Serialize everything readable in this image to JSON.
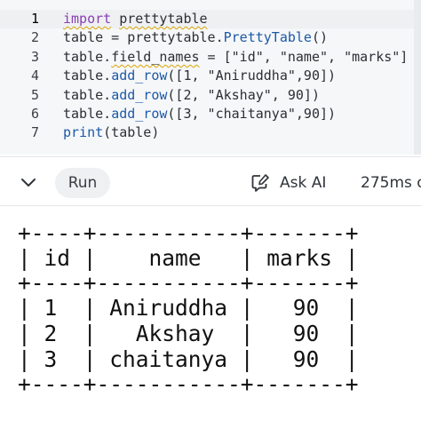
{
  "editor": {
    "lines": [
      {
        "n": "1",
        "parts": [
          {
            "t": "import",
            "c": "kw squiggle"
          },
          {
            "t": " ",
            "c": ""
          },
          {
            "t": "prettytable",
            "c": "squiggle"
          }
        ]
      },
      {
        "n": "2",
        "parts": [
          {
            "t": "table = prettytable.",
            "c": ""
          },
          {
            "t": "PrettyTable",
            "c": "fn"
          },
          {
            "t": "()",
            "c": ""
          }
        ]
      },
      {
        "n": "3",
        "parts": [
          {
            "t": "table.",
            "c": ""
          },
          {
            "t": "field_names",
            "c": "squiggle"
          },
          {
            "t": " = [\"id\", \"name\", \"marks\"]",
            "c": ""
          }
        ]
      },
      {
        "n": "4",
        "parts": [
          {
            "t": "table.",
            "c": ""
          },
          {
            "t": "add_row",
            "c": "fn"
          },
          {
            "t": "([1, \"Aniruddha\",90])",
            "c": ""
          }
        ]
      },
      {
        "n": "5",
        "parts": [
          {
            "t": "table.",
            "c": ""
          },
          {
            "t": "add_row",
            "c": "fn"
          },
          {
            "t": "([2, \"Akshay\", 90])",
            "c": ""
          }
        ]
      },
      {
        "n": "6",
        "parts": [
          {
            "t": "table.",
            "c": ""
          },
          {
            "t": "add_row",
            "c": "fn"
          },
          {
            "t": "([3, \"chaitanya\",90])",
            "c": ""
          }
        ]
      },
      {
        "n": "7",
        "parts": [
          {
            "t": "print",
            "c": "fn"
          },
          {
            "t": "(table)",
            "c": ""
          }
        ]
      }
    ]
  },
  "runbar": {
    "collapse_icon": "chevron-down-icon",
    "run_label": "Run",
    "ask_icon": "ai-edit-icon",
    "ask_label": "Ask AI",
    "timing": "275ms on"
  },
  "output": {
    "lines": [
      "+----+-----------+-------+",
      "| id |    name   | marks |",
      "+----+-----------+-------+",
      "| 1  | Aniruddha |   90  |",
      "| 2  |   Akshay  |   90  |",
      "| 3  | chaitanya |   90  |",
      "+----+-----------+-------+"
    ]
  }
}
